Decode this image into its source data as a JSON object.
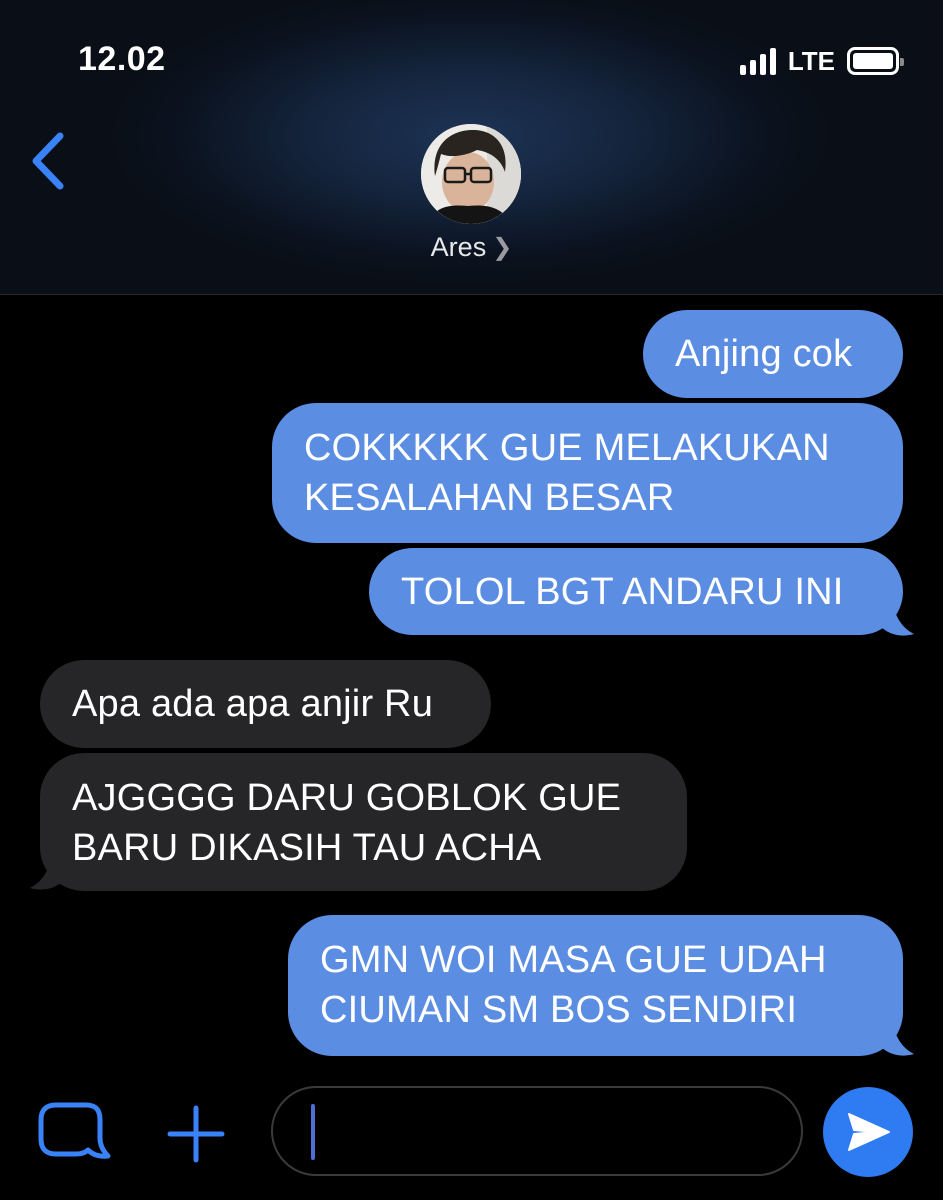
{
  "status_bar": {
    "time": "12.02",
    "network": "LTE",
    "signal_bars": 4,
    "battery_level": 1.0
  },
  "header": {
    "contact_name": "Ares",
    "back_icon": "chevron-left-icon",
    "avatar_icon": "contact-photo"
  },
  "messages": [
    {
      "direction": "outgoing",
      "text": "Anjing cok"
    },
    {
      "direction": "outgoing",
      "text": "COKKKKK GUE MELAKUKAN\nKESALAHAN BESAR"
    },
    {
      "direction": "outgoing",
      "text": "TOLOL BGT ANDARU INI"
    },
    {
      "direction": "incoming",
      "text": "Apa ada apa anjir Ru"
    },
    {
      "direction": "incoming",
      "text": "AJGGGG DARU GOBLOK GUE\nBARU DIKASIH TAU ACHA"
    },
    {
      "direction": "outgoing",
      "text": "GMN WOI MASA GUE UDAH\nCIUMAN SM BOS SENDIRI"
    }
  ],
  "composer": {
    "input_value": "",
    "apps_icon": "app-store-icon",
    "plus_icon": "plus-icon",
    "send_icon": "send-arrow-icon"
  },
  "colors": {
    "outgoing_bubble": "#5b8ee3",
    "incoming_bubble": "#262628",
    "accent": "#2f7bf2",
    "back_chevron": "#3a82f7"
  }
}
